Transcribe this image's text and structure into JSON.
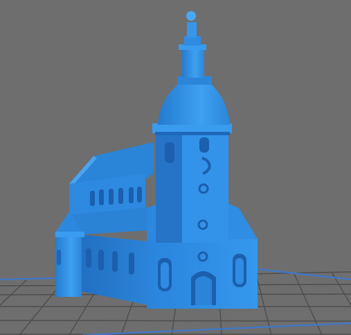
{
  "viewport": {
    "background_color": "#6e6e6e",
    "grid_color": "#4a4a4a",
    "grid_edge_color": "#3e78c9",
    "model_color": "#2f8ee6",
    "model_shadow_color": "#1b5fae",
    "model_highlight_color": "#5fb3f7"
  }
}
